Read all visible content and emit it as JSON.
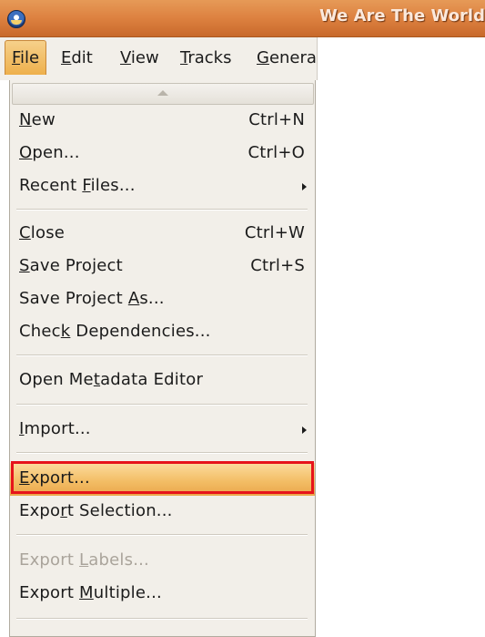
{
  "window": {
    "title": "We Are The World",
    "icon": "audacity-app-icon"
  },
  "menubar": {
    "items": [
      {
        "id": "file",
        "pre": "",
        "mn": "F",
        "post": "ile"
      },
      {
        "id": "edit",
        "pre": "",
        "mn": "E",
        "post": "dit"
      },
      {
        "id": "view",
        "pre": "",
        "mn": "V",
        "post": "iew"
      },
      {
        "id": "tracks",
        "pre": "",
        "mn": "T",
        "post": "racks"
      },
      {
        "id": "generate",
        "pre": "",
        "mn": "G",
        "post": "enera"
      }
    ]
  },
  "file_menu": {
    "scroll_up_icon": "scroll-up-arrow-icon",
    "items": [
      {
        "pre": "",
        "mn": "N",
        "post": "ew",
        "accel": "Ctrl+N"
      },
      {
        "pre": "",
        "mn": "O",
        "post": "pen...",
        "accel": "Ctrl+O"
      },
      {
        "pre": "Recent ",
        "mn": "F",
        "post": "iles...",
        "submenu": true
      },
      {
        "pre": "",
        "mn": "C",
        "post": "lose",
        "accel": "Ctrl+W"
      },
      {
        "pre": "",
        "mn": "S",
        "post": "ave Project",
        "accel": "Ctrl+S"
      },
      {
        "pre": "Save Project ",
        "mn": "A",
        "post": "s..."
      },
      {
        "pre": "Chec",
        "mn": "k",
        "post": " Dependencies..."
      },
      {
        "pre": "Open Me",
        "mn": "t",
        "post": "adata Editor"
      },
      {
        "pre": "",
        "mn": "I",
        "post": "mport...",
        "submenu": true
      },
      {
        "pre": "",
        "mn": "E",
        "post": "xport..."
      },
      {
        "pre": "Expo",
        "mn": "r",
        "post": "t Selection..."
      },
      {
        "pre": "Export ",
        "mn": "L",
        "post": "abels...",
        "disabled": true
      },
      {
        "pre": "Export ",
        "mn": "M",
        "post": "ultiple..."
      }
    ]
  },
  "colors": {
    "titlebar": "#dd8140",
    "selection": "#f3be66",
    "annotation_box": "#e6131b"
  }
}
